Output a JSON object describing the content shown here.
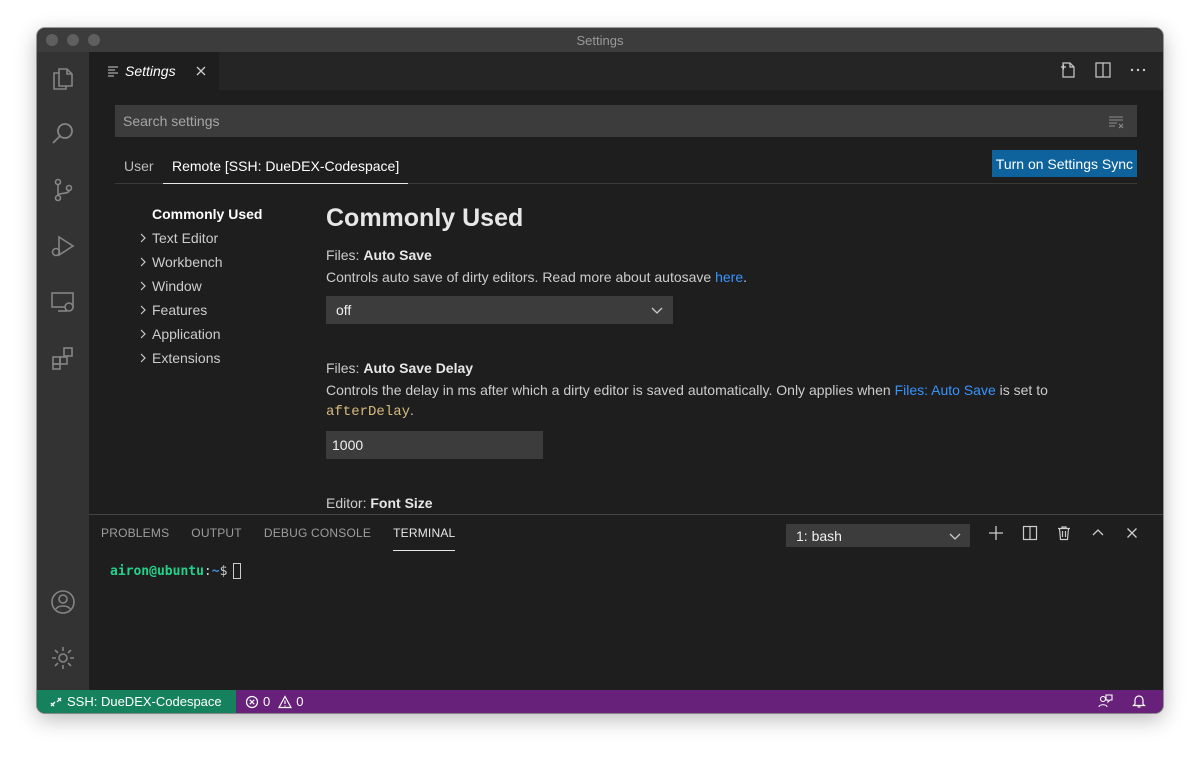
{
  "window": {
    "title": "Settings"
  },
  "tab": {
    "label": "Settings"
  },
  "search": {
    "placeholder": "Search settings"
  },
  "scopes": {
    "user": "User",
    "remote": "Remote [SSH: DueDEX-Codespace]"
  },
  "sync_button": "Turn on Settings Sync",
  "toc": {
    "active": "Commonly Used",
    "items": [
      "Text Editor",
      "Workbench",
      "Window",
      "Features",
      "Application",
      "Extensions"
    ]
  },
  "content": {
    "section_title": "Commonly Used",
    "auto_save": {
      "category": "Files: ",
      "name": "Auto Save",
      "desc_before": "Controls auto save of dirty editors. Read more about autosave ",
      "desc_link": "here",
      "desc_after": ".",
      "value": "off"
    },
    "auto_save_delay": {
      "category": "Files: ",
      "name": "Auto Save Delay",
      "desc_before": "Controls the delay in ms after which a dirty editor is saved automatically. Only applies when ",
      "desc_link": "Files: Auto Save",
      "desc_middle": " is set to ",
      "desc_code": "afterDelay",
      "desc_after": ".",
      "value": "1000"
    },
    "font_size": {
      "category": "Editor: ",
      "name": "Font Size"
    }
  },
  "panel": {
    "tabs": [
      "PROBLEMS",
      "OUTPUT",
      "DEBUG CONSOLE",
      "TERMINAL"
    ],
    "active_tab": "TERMINAL",
    "terminal_select": "1: bash",
    "prompt": {
      "user_host": "airon@ubuntu",
      "colon": ":",
      "path": "~",
      "dollar": "$"
    }
  },
  "statusbar": {
    "remote": "SSH: DueDEX-Codespace",
    "errors": "0",
    "warnings": "0"
  },
  "colors": {
    "accent": "#0e639c",
    "statusbar": "#68217a",
    "remote": "#16825d",
    "link": "#3794ff"
  }
}
